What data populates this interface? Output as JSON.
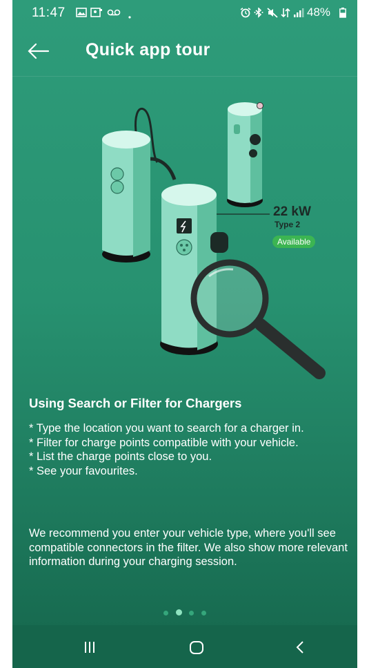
{
  "status_bar": {
    "time": "11:47",
    "battery": "48%",
    "left_icons": [
      "gallery-icon",
      "photo-icon",
      "voicemail-icon",
      "dot-icon"
    ],
    "right_icons": [
      "alarm-icon",
      "bluetooth-icon",
      "mute-icon",
      "data-icon",
      "signal-icon",
      "battery-icon"
    ]
  },
  "app_bar": {
    "title": "Quick app tour",
    "back_icon": "arrow-left-icon"
  },
  "illustration": {
    "power": "22 kW",
    "connector": "Type 2",
    "status": "Available"
  },
  "content": {
    "heading": "Using Search or Filter for Chargers",
    "bullets": [
      "* Type the location you want to search for a charger in.",
      "* Filter for charge points compatible with your vehicle.",
      "* List the charge points close to you.",
      "* See your favourites."
    ],
    "recommend": "We recommend you enter your vehicle type, where you'll see compatible connectors in the filter.  We also show more relevant information during your charging session."
  },
  "pager": {
    "total": 4,
    "active": 2
  },
  "nav_bar": {
    "buttons": [
      "recent-apps-icon",
      "home-icon",
      "back-icon"
    ]
  },
  "colors": {
    "background": "#279170",
    "nav_bar": "#15654b",
    "charger_body": "#8fdcc4",
    "available_badge": "#3cb552"
  }
}
